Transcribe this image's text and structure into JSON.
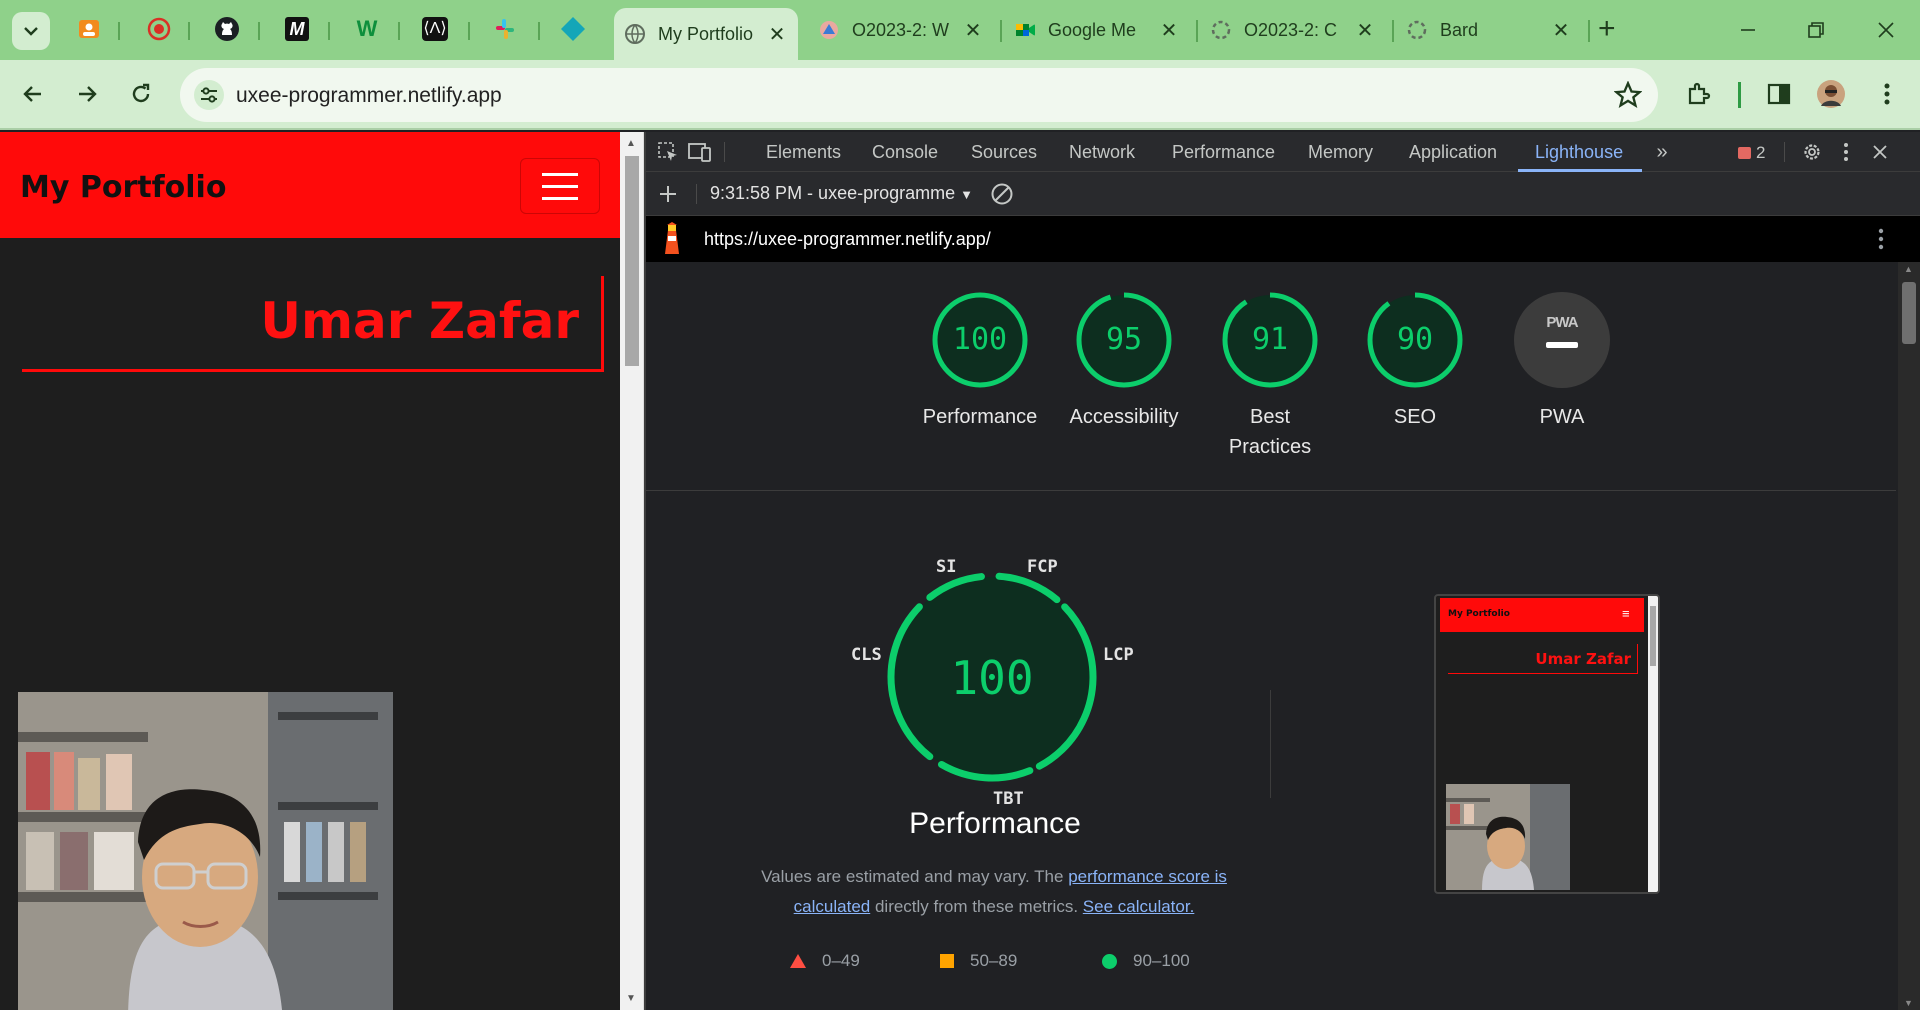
{
  "browser": {
    "tabs": [
      {
        "title": "My Portfolio",
        "active": true
      },
      {
        "title": "O2023-2: W",
        "active": false
      },
      {
        "title": "Google Me",
        "active": false
      },
      {
        "title": "O2023-2: C",
        "active": false
      },
      {
        "title": "Bard",
        "active": false
      }
    ],
    "url": "uxee-programmer.netlify.app",
    "colors": {
      "tabstrip": "#8fd18a",
      "toolbar": "#d3edd0"
    }
  },
  "page": {
    "logo": "My Portfolio",
    "hero_name": "Umar Zafar",
    "colors": {
      "accent": "#ff0a0a",
      "background": "#1e1e1e"
    }
  },
  "devtools": {
    "tabs": [
      "Elements",
      "Console",
      "Sources",
      "Network",
      "Performance",
      "Memory",
      "Application",
      "Lighthouse"
    ],
    "active_tab": "Lighthouse",
    "error_count": "2",
    "report_select": "9:31:58 PM - uxee-programme",
    "report_url": "https://uxee-programmer.netlify.app/"
  },
  "lighthouse": {
    "categories": [
      {
        "label": "Performance",
        "score": "100",
        "fraction": 1.0
      },
      {
        "label": "Accessibility",
        "score": "95",
        "fraction": 0.95
      },
      {
        "label": "Best Practices",
        "score": "91",
        "fraction": 0.91
      },
      {
        "label": "SEO",
        "score": "90",
        "fraction": 0.9
      },
      {
        "label": "PWA",
        "score": "",
        "fraction": 0
      }
    ],
    "pwa_badge": "PWA",
    "performance": {
      "score": "100",
      "title": "Performance",
      "metrics": [
        "SI",
        "FCP",
        "LCP",
        "TBT",
        "CLS"
      ],
      "desc_prefix": "Values are estimated and may vary. The ",
      "desc_link1": "performance score is calculated",
      "desc_mid": " directly from these metrics. ",
      "desc_link2": "See calculator."
    },
    "legend": [
      {
        "range": "0–49",
        "color": "#ff4e42",
        "shape": "triangle"
      },
      {
        "range": "50–89",
        "color": "#ffa400",
        "shape": "square"
      },
      {
        "range": "90–100",
        "color": "#0cce6b",
        "shape": "circle"
      }
    ],
    "thumbnail": {
      "logo": "My Portfolio",
      "name": "Umar Zafar"
    },
    "colors": {
      "pass": "#0cce6b",
      "pass_bg": "#0d2e1f"
    }
  }
}
